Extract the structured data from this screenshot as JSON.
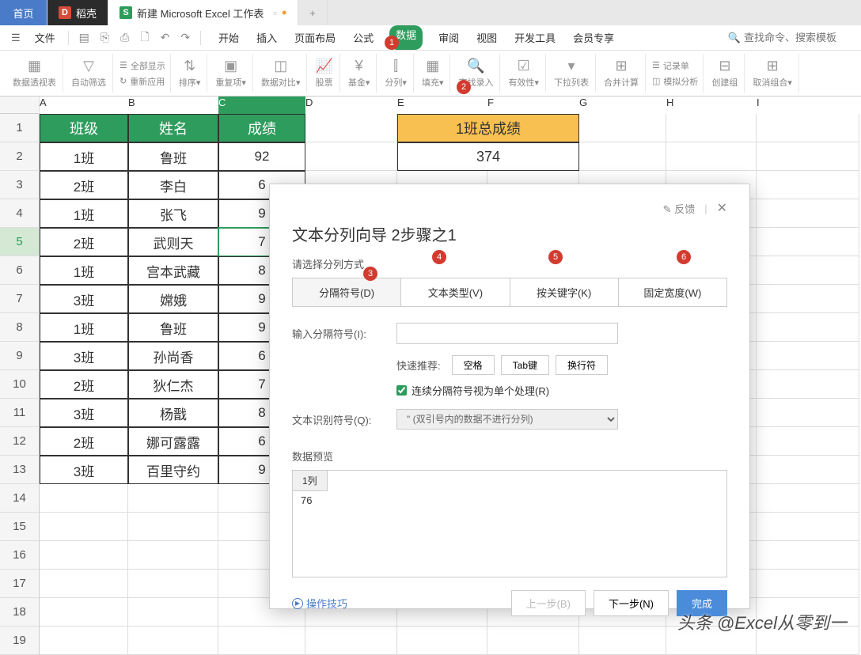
{
  "tabs": {
    "home": "首页",
    "doke": "稻壳",
    "active": "新建 Microsoft Excel 工作表"
  },
  "menu": {
    "file": "文件",
    "items": [
      "开始",
      "插入",
      "页面布局",
      "公式",
      "数据",
      "审阅",
      "视图",
      "开发工具",
      "会员专享"
    ],
    "search_placeholder": "查找命令、搜索模板"
  },
  "ribbon": {
    "pivot": "数据透视表",
    "autofilter": "自动筛选",
    "showall": "全部显示",
    "reapply": "重新应用",
    "sort": "排序",
    "dup": "重复项",
    "compare": "数据对比",
    "stock": "股票",
    "fund": "基金",
    "split": "分列",
    "fill": "填充",
    "lookup": "查找录入",
    "valid": "有效性",
    "dropdown": "下拉列表",
    "consol": "合并计算",
    "record": "记录单",
    "sim": "模拟分析",
    "group": "创建组",
    "ungroup": "取消组合"
  },
  "columns": [
    "A",
    "B",
    "C",
    "D",
    "E",
    "F",
    "G",
    "H",
    "I"
  ],
  "headers": [
    "班级",
    "姓名",
    "成绩"
  ],
  "merged_header": "1班总成绩",
  "merged_value": "374",
  "rows": [
    {
      "n": 1
    },
    {
      "n": 2,
      "a": "1班",
      "b": "鲁班",
      "c": "92"
    },
    {
      "n": 3,
      "a": "2班",
      "b": "李白",
      "c": "6"
    },
    {
      "n": 4,
      "a": "1班",
      "b": "张飞",
      "c": "9"
    },
    {
      "n": 5,
      "a": "2班",
      "b": "武则天",
      "c": "7"
    },
    {
      "n": 6,
      "a": "1班",
      "b": "宫本武藏",
      "c": "8"
    },
    {
      "n": 7,
      "a": "3班",
      "b": "嫦娥",
      "c": "9"
    },
    {
      "n": 8,
      "a": "1班",
      "b": "鲁班",
      "c": "9"
    },
    {
      "n": 9,
      "a": "3班",
      "b": "孙尚香",
      "c": "6"
    },
    {
      "n": 10,
      "a": "2班",
      "b": "狄仁杰",
      "c": "7"
    },
    {
      "n": 11,
      "a": "3班",
      "b": "杨戬",
      "c": "8"
    },
    {
      "n": 12,
      "a": "2班",
      "b": "娜可露露",
      "c": "6"
    },
    {
      "n": 13,
      "a": "3班",
      "b": "百里守约",
      "c": "9"
    },
    {
      "n": 14
    },
    {
      "n": 15
    },
    {
      "n": 16
    },
    {
      "n": 17
    },
    {
      "n": 18
    },
    {
      "n": 19
    }
  ],
  "dialog": {
    "feedback": "反馈",
    "title": "文本分列向导 2步骤之1",
    "subtitle": "请选择分列方式",
    "tabs": [
      "分隔符号(D)",
      "文本类型(V)",
      "按关键字(K)",
      "固定宽度(W)"
    ],
    "input_label": "输入分隔符号(I):",
    "quick_label": "快速推荐:",
    "quick_btns": [
      "空格",
      "Tab键",
      "换行符"
    ],
    "checkbox": "连续分隔符号视为单个处理(R)",
    "recog_label": "文本识别符号(Q):",
    "recog_value": "\" (双引号内的数据不进行分列)",
    "preview_label": "数据预览",
    "preview_col": "1列",
    "preview_data": "76",
    "tips": "操作技巧",
    "prev_btn": "上一步(B)",
    "next_btn": "下一步(N)",
    "finish_btn": "完成"
  },
  "badges": [
    "1",
    "2",
    "3",
    "4",
    "5",
    "6"
  ],
  "watermark": "头条 @Excel从零到一"
}
